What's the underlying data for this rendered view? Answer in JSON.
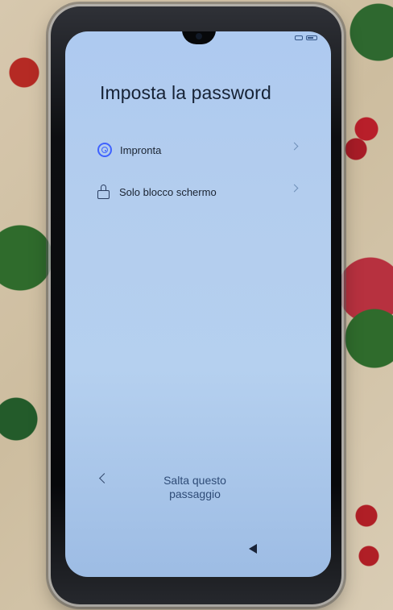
{
  "screen": {
    "title": "Imposta la password",
    "items": [
      {
        "label": "Impronta",
        "icon": "fingerprint-icon",
        "accent": "#3f62ff"
      },
      {
        "label": "Solo blocco schermo",
        "icon": "lock-icon",
        "accent": "#2a3d60"
      }
    ],
    "skip_label": "Salta questo\npassaggio",
    "navigation": {
      "back_icon": "chevron-left-icon",
      "system_back_icon": "triangle-back-icon"
    }
  }
}
